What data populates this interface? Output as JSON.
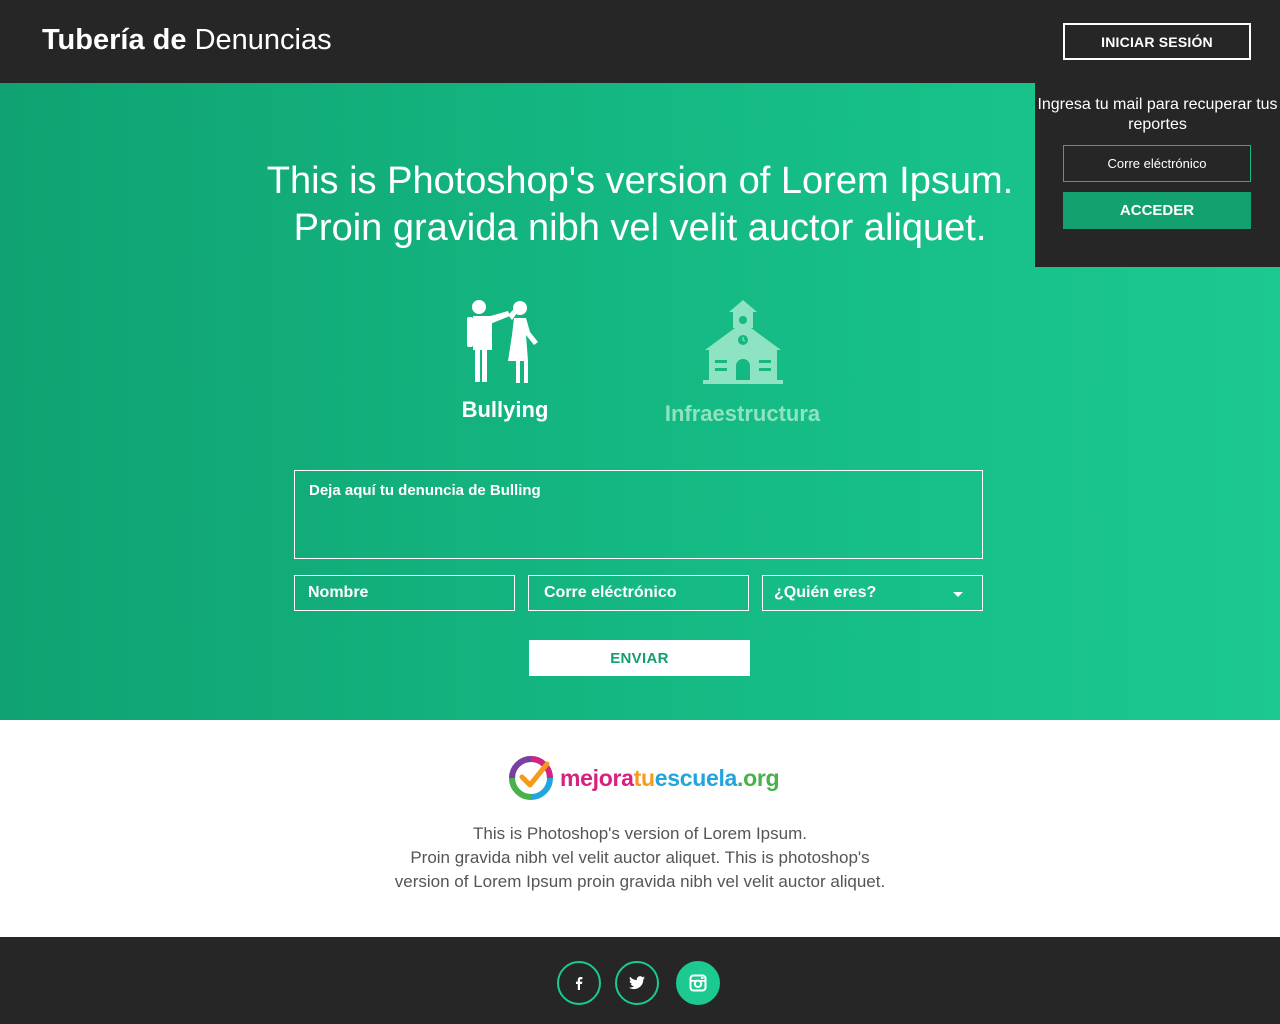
{
  "header": {
    "brand_bold": "Tubería de",
    "brand_light": "Denuncias",
    "login_label": "INICIAR SESIÓN"
  },
  "login_panel": {
    "prompt": "Ingresa tu mail para recuperar tus reportes",
    "email_placeholder": "Corre eléctrónico",
    "submit_label": "ACCEDER"
  },
  "hero": {
    "headline_line1": "This is Photoshop's version  of Lorem Ipsum.",
    "headline_line2": "Proin gravida nibh vel velit auctor aliquet.",
    "categories": [
      {
        "label": "Bullying",
        "icon": "bullying-icon",
        "active": true
      },
      {
        "label": "Infraestructura",
        "icon": "school-icon",
        "active": false
      }
    ]
  },
  "form": {
    "report_placeholder": "Deja aquí tu denuncia de Bulling",
    "name_placeholder": "Nombre",
    "email_placeholder": "Corre eléctrónico",
    "who_placeholder": "¿Quién eres?",
    "submit_label": "ENVIAR"
  },
  "about": {
    "logo": {
      "p1": "mejora",
      "p2": "tu",
      "p3": "escuela",
      "p4": ".org"
    },
    "line1": "This is Photoshop's version  of Lorem Ipsum.",
    "line2": "Proin gravida nibh vel velit auctor aliquet. This is photoshop's",
    "line3": "version  of Lorem Ipsum proin gravida nibh vel velit auctor aliquet."
  },
  "footer": {
    "social": [
      "facebook-icon",
      "twitter-icon",
      "instagram-icon"
    ]
  },
  "colors": {
    "dark": "#262626",
    "accent": "#1cc991",
    "accent_dark": "#129e6f"
  }
}
